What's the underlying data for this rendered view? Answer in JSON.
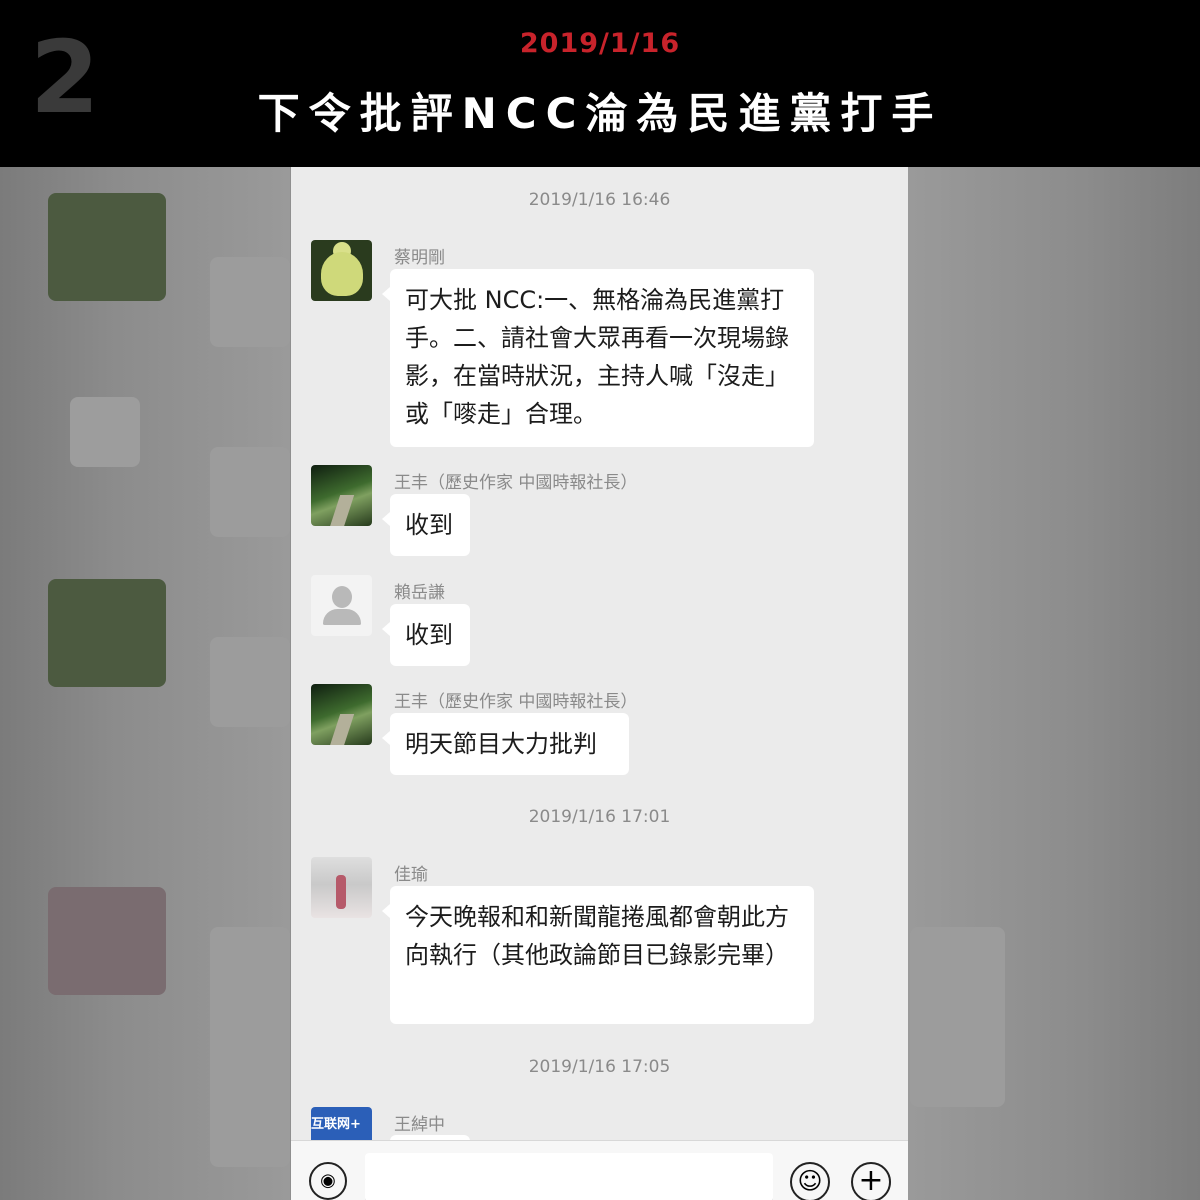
{
  "banner": {
    "number": "2",
    "date": "2019/1/16",
    "title": "下令批評NCC淪為民進黨打手"
  },
  "chat": {
    "messages": [
      {
        "timestamp": "2019/1/16 16:46"
      },
      {
        "sender": "蔡明剛",
        "avatar": "buddha-statue-avatar",
        "text": "可大批 NCC:一、無格淪為民進黨打手。二、請社會大眾再看一次現場錄影，在當時狀況，主持人喊「沒走」或「嘜走」合理。"
      },
      {
        "sender": "王丰（歷史作家 中國時報社長）",
        "avatar": "forest-path-avatar",
        "text": "收到"
      },
      {
        "sender": "賴岳謙",
        "avatar": "default-user-avatar",
        "text": "收到"
      },
      {
        "sender": "王丰（歷史作家 中國時報社長）",
        "avatar": "forest-path-avatar",
        "text": "明天節目大力批判"
      },
      {
        "timestamp": "2019/1/16 17:01"
      },
      {
        "sender": "佳瑜",
        "avatar": "person-photo-avatar",
        "text": "今天晚報和和新聞龍捲風都會朝此方向執行（其他政論節目已錄影完畢）"
      },
      {
        "timestamp": "2019/1/16 17:05"
      },
      {
        "sender": "王綽中",
        "avatar": "logo-avatar",
        "avatar_text": "互联网+"
      }
    ]
  },
  "input_bar": {
    "voice_icon": "voice-icon",
    "emoji_icon": "emoji-icon",
    "plus_icon": "plus-icon"
  },
  "colors": {
    "banner_bg": "#000000",
    "date_red": "#c8232b",
    "chat_bg": "#ebebeb",
    "bubble_bg": "#ffffff"
  }
}
